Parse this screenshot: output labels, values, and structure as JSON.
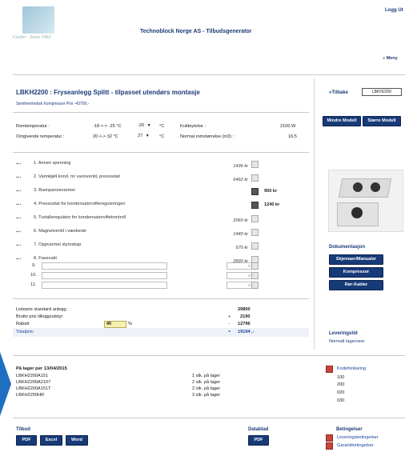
{
  "header": {
    "title": "Technoblock Norge AS - Tilbudsgenerator",
    "logout": "Logg Ut",
    "menu": "» Meny"
  },
  "product": {
    "title": "LBKH2200 : Fryseanlegg Splitt - tilpasset utendørs montasje",
    "compressor_price": "Semihermetisk Kompressor Pris -43700,-",
    "back": "«Tilbake",
    "code": "LBKH2200",
    "btn_smaller": "Mindre Modell",
    "btn_larger": "Større Modell"
  },
  "conditions": {
    "room_label": "Romtemperatur :",
    "room_range": "-18 <-> -25 °C",
    "room_value": "-20",
    "room_unit": "°C",
    "ambient_label": "Omgivende temperatur :",
    "ambient_range": "20 <-> 32 °C",
    "ambient_value": "27",
    "ambient_unit": "°C",
    "cooling_label": "Kuldeytelse :",
    "cooling_value": "2100 W",
    "volume_label": "Normal romstørrelse (m3) :",
    "volume_value": "16.5"
  },
  "options": [
    {
      "label": "1. Annen spenning",
      "price": "1436 kr",
      "checked": false,
      "selected": ""
    },
    {
      "label": "2. Vannkjølt kond. m/ vannventil, pressostat",
      "price": "6462 kr",
      "checked": false,
      "selected": ""
    },
    {
      "label": "3. Bunnpannevarmer",
      "price": "",
      "checked": true,
      "selected": "950 kr"
    },
    {
      "label": "4. Pressostat for kondensatorviftereguleringen",
      "price": "",
      "checked": true,
      "selected": "1240 kr"
    },
    {
      "label": "5. Turtallsregulator for kondensatorviftekontroll",
      "price": "2060 kr",
      "checked": false,
      "selected": ""
    },
    {
      "label": "6. Magnetventil i væskerør",
      "price": "1440 kr",
      "checked": false,
      "selected": ""
    },
    {
      "label": "7. Oppvarmet styreskap",
      "price": "570 kr",
      "checked": false,
      "selected": ""
    },
    {
      "label": "8. Fasevakt",
      "price": "2830 kr",
      "checked": false,
      "selected": ""
    }
  ],
  "extra_rows": [
    {
      "label": "9.",
      "price_placeholder": "kr"
    },
    {
      "label": "10.",
      "price_placeholder": "kr"
    },
    {
      "label": "11.",
      "price_placeholder": "kr"
    }
  ],
  "totals": {
    "list_label": "Listepris standard anlegg:",
    "list_value": "29800",
    "gross_label": "Brutto pris tilleggsutstyr:",
    "gross_sign": "+",
    "gross_value": "2190",
    "discount_label": "Rabatt",
    "discount_pct": "40",
    "discount_unit": "%",
    "discount_sign": "-",
    "discount_value": "12796",
    "total_label": "Totalpris:",
    "total_sign": "=",
    "total_value": "19194",
    "total_suffix": ",-"
  },
  "documentation": {
    "title": "Dokumentasjon",
    "buttons": [
      "Skjemaer/Manualer",
      "Kompressor",
      "Rør-Kabler"
    ]
  },
  "delivery": {
    "title": "Leveringstid",
    "value": "Normalt lagervare"
  },
  "stock": {
    "title": "På lager per 13/04/2015",
    "rows": [
      {
        "code": "LBKH2200A151",
        "status": "1 stk. på lager"
      },
      {
        "code": "LBKH2200A2107",
        "status": "2 stk. på lager"
      },
      {
        "code": "LBKH2200A151T",
        "status": "2 stk. på lager"
      },
      {
        "code": "LBKH2200HR",
        "status": "3 stk. på lager"
      }
    ]
  },
  "codes": {
    "link": "Kodeforklaring",
    "values": [
      "100",
      "200",
      "020",
      "030"
    ]
  },
  "bottom": {
    "offer_title": "Tilbud",
    "offer_buttons": [
      "PDF",
      "Excel",
      "Word"
    ],
    "datasheet_title": "Datablad",
    "datasheet_button": "PDF",
    "terms_title": "Betingelser",
    "terms_links": [
      "Leveringsbetingelser",
      "Garantibetingelser"
    ]
  }
}
